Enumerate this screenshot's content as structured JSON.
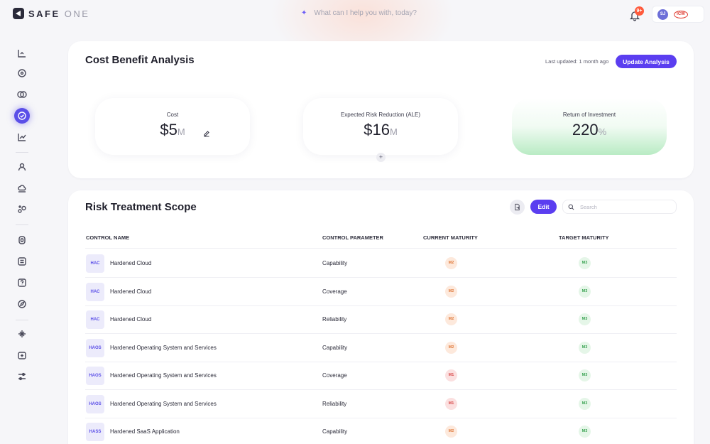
{
  "app": {
    "logo_main": "SAFE",
    "logo_sub": "ONE"
  },
  "topbar": {
    "ask_placeholder": "What can I help you with, today?",
    "notification_badge": "9+",
    "user_initials": "SJ",
    "brand": "ICW"
  },
  "sidebar": {
    "items": [
      {
        "icon": "dashboard-icon"
      },
      {
        "icon": "target-icon"
      },
      {
        "icon": "toggle-icon"
      },
      {
        "icon": "shield-check-icon",
        "active": true
      },
      {
        "icon": "trend-chart-icon"
      },
      {
        "icon": "user-icon"
      },
      {
        "icon": "cloud-icon"
      },
      {
        "icon": "nodes-icon"
      },
      {
        "icon": "chip-icon"
      },
      {
        "icon": "list-icon"
      },
      {
        "icon": "help-icon"
      },
      {
        "icon": "compass-icon"
      },
      {
        "icon": "sparkle-icon"
      },
      {
        "icon": "plus-box-icon"
      },
      {
        "icon": "sliders-icon"
      }
    ]
  },
  "cost_benefit": {
    "title": "Cost Benefit Analysis",
    "last_updated": "Last updated: 1 month ago",
    "update_button": "Update Analysis",
    "cost": {
      "label": "Cost",
      "value": "$5",
      "unit": "M"
    },
    "risk_reduction": {
      "label": "Expected Risk Reduction (ALE)",
      "value": "$16",
      "unit": "M"
    },
    "roi": {
      "label": "Return of Investment",
      "value": "220",
      "unit": "%"
    },
    "add_label": "+"
  },
  "risk_treatment": {
    "title": "Risk Treatment Scope",
    "edit_button": "Edit",
    "search_placeholder": "Search",
    "columns": [
      "CONTROL NAME",
      "CONTROL PARAMETER",
      "CURRENT MATURITY",
      "TARGET MATURITY"
    ],
    "rows": [
      {
        "abbr": "HAC",
        "name": "Hardened Cloud",
        "parameter": "Capability",
        "current": "M2",
        "target": "M3"
      },
      {
        "abbr": "HAC",
        "name": "Hardened Cloud",
        "parameter": "Coverage",
        "current": "M2",
        "target": "M3"
      },
      {
        "abbr": "HAC",
        "name": "Hardened Cloud",
        "parameter": "Reliability",
        "current": "M2",
        "target": "M3"
      },
      {
        "abbr": "HAOS",
        "name": "Hardened Operating System and Services",
        "parameter": "Capability",
        "current": "M2",
        "target": "M3"
      },
      {
        "abbr": "HAOS",
        "name": "Hardened Operating System and Services",
        "parameter": "Coverage",
        "current": "M1",
        "target": "M3"
      },
      {
        "abbr": "HAOS",
        "name": "Hardened Operating System and Services",
        "parameter": "Reliability",
        "current": "M1",
        "target": "M3"
      },
      {
        "abbr": "HASS",
        "name": "Hardened SaaS Application",
        "parameter": "Capability",
        "current": "M2",
        "target": "M3"
      }
    ]
  },
  "colors": {
    "accent": "#5b3ef0",
    "m1": "#d84b4b",
    "m2": "#e07a3c",
    "m3": "#3aa352"
  }
}
